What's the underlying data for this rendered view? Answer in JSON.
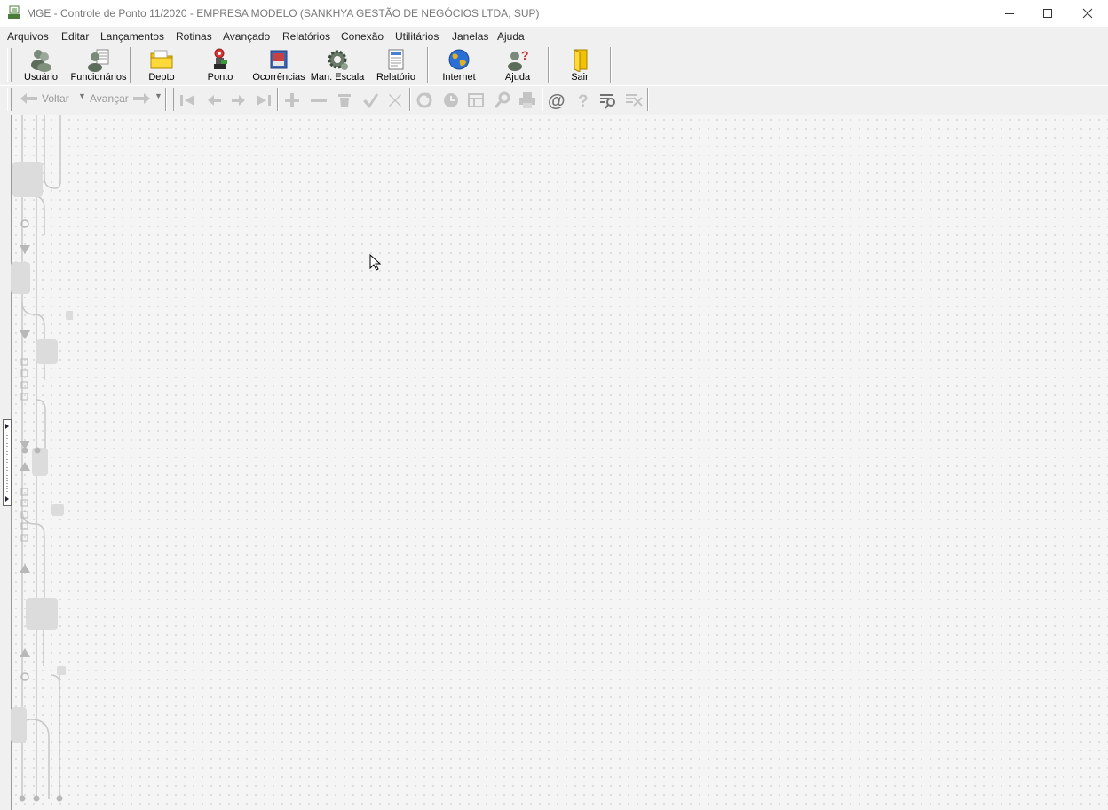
{
  "window": {
    "title": "MGE - Controle de Ponto 11/2020 - EMPRESA MODELO (SANKHYA GESTÃO DE NEGÓCIOS LTDA, SUP)",
    "controls": [
      "minimize-icon",
      "maximize-icon",
      "close-icon"
    ]
  },
  "menu": {
    "items": [
      "Arquivos",
      "Editar",
      "Lançamentos",
      "Rotinas",
      "Avançado",
      "Relatórios",
      "Conexão",
      "Utilitários",
      "Janelas",
      "Ajuda"
    ]
  },
  "toolbar": {
    "buttons": [
      {
        "label": "Usuário",
        "icon": "users-icon"
      },
      {
        "label": "Funcionários",
        "icon": "employees-icon"
      },
      {
        "label": "Depto",
        "icon": "folder-icon"
      },
      {
        "label": "Ponto",
        "icon": "timeclock-icon"
      },
      {
        "label": "Ocorrências",
        "icon": "occurrences-icon"
      },
      {
        "label": "Man. Escala",
        "icon": "gear-icon"
      },
      {
        "label": "Relatório",
        "icon": "report-icon"
      },
      {
        "label": "Internet",
        "icon": "globe-icon"
      },
      {
        "label": "Ajuda",
        "icon": "help-user-icon"
      },
      {
        "label": "Sair",
        "icon": "exit-door-icon"
      }
    ]
  },
  "navbar": {
    "back_label": "Voltar",
    "forward_label": "Avançar",
    "icons": [
      "first-record-icon",
      "previous-record-icon",
      "next-record-icon",
      "last-record-icon",
      "add-icon",
      "remove-icon",
      "delete-icon",
      "confirm-icon",
      "cancel-icon",
      "refresh-icon",
      "clock-icon",
      "grid-icon",
      "search-icon",
      "print-icon",
      "email-icon",
      "help-icon",
      "filter-icon",
      "clear-filter-icon"
    ]
  },
  "colors": {
    "accent_yellow": "#f2c200",
    "globe_blue": "#2a6fd6",
    "disabled_gray": "#a8a8a8"
  }
}
